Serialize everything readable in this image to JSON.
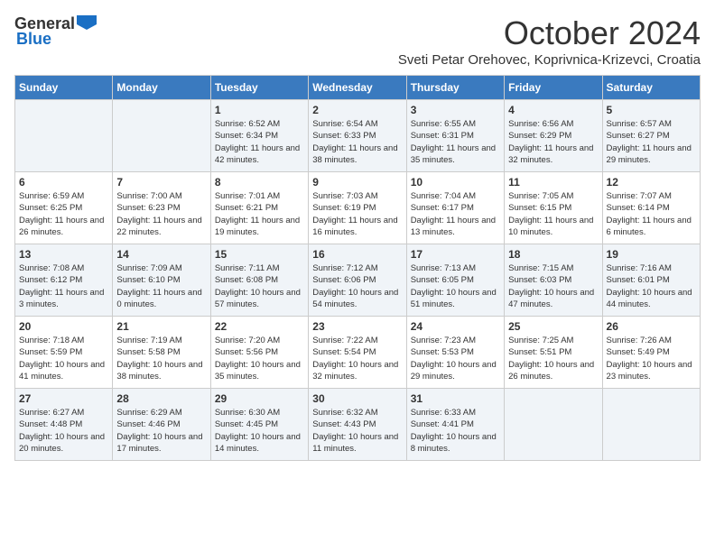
{
  "header": {
    "logo_general": "General",
    "logo_blue": "Blue",
    "month": "October 2024",
    "location": "Sveti Petar Orehovec, Koprivnica-Krizevci, Croatia"
  },
  "weekdays": [
    "Sunday",
    "Monday",
    "Tuesday",
    "Wednesday",
    "Thursday",
    "Friday",
    "Saturday"
  ],
  "weeks": [
    [
      {
        "day": "",
        "info": ""
      },
      {
        "day": "",
        "info": ""
      },
      {
        "day": "1",
        "info": "Sunrise: 6:52 AM\nSunset: 6:34 PM\nDaylight: 11 hours and 42 minutes."
      },
      {
        "day": "2",
        "info": "Sunrise: 6:54 AM\nSunset: 6:33 PM\nDaylight: 11 hours and 38 minutes."
      },
      {
        "day": "3",
        "info": "Sunrise: 6:55 AM\nSunset: 6:31 PM\nDaylight: 11 hours and 35 minutes."
      },
      {
        "day": "4",
        "info": "Sunrise: 6:56 AM\nSunset: 6:29 PM\nDaylight: 11 hours and 32 minutes."
      },
      {
        "day": "5",
        "info": "Sunrise: 6:57 AM\nSunset: 6:27 PM\nDaylight: 11 hours and 29 minutes."
      }
    ],
    [
      {
        "day": "6",
        "info": "Sunrise: 6:59 AM\nSunset: 6:25 PM\nDaylight: 11 hours and 26 minutes."
      },
      {
        "day": "7",
        "info": "Sunrise: 7:00 AM\nSunset: 6:23 PM\nDaylight: 11 hours and 22 minutes."
      },
      {
        "day": "8",
        "info": "Sunrise: 7:01 AM\nSunset: 6:21 PM\nDaylight: 11 hours and 19 minutes."
      },
      {
        "day": "9",
        "info": "Sunrise: 7:03 AM\nSunset: 6:19 PM\nDaylight: 11 hours and 16 minutes."
      },
      {
        "day": "10",
        "info": "Sunrise: 7:04 AM\nSunset: 6:17 PM\nDaylight: 11 hours and 13 minutes."
      },
      {
        "day": "11",
        "info": "Sunrise: 7:05 AM\nSunset: 6:15 PM\nDaylight: 11 hours and 10 minutes."
      },
      {
        "day": "12",
        "info": "Sunrise: 7:07 AM\nSunset: 6:14 PM\nDaylight: 11 hours and 6 minutes."
      }
    ],
    [
      {
        "day": "13",
        "info": "Sunrise: 7:08 AM\nSunset: 6:12 PM\nDaylight: 11 hours and 3 minutes."
      },
      {
        "day": "14",
        "info": "Sunrise: 7:09 AM\nSunset: 6:10 PM\nDaylight: 11 hours and 0 minutes."
      },
      {
        "day": "15",
        "info": "Sunrise: 7:11 AM\nSunset: 6:08 PM\nDaylight: 10 hours and 57 minutes."
      },
      {
        "day": "16",
        "info": "Sunrise: 7:12 AM\nSunset: 6:06 PM\nDaylight: 10 hours and 54 minutes."
      },
      {
        "day": "17",
        "info": "Sunrise: 7:13 AM\nSunset: 6:05 PM\nDaylight: 10 hours and 51 minutes."
      },
      {
        "day": "18",
        "info": "Sunrise: 7:15 AM\nSunset: 6:03 PM\nDaylight: 10 hours and 47 minutes."
      },
      {
        "day": "19",
        "info": "Sunrise: 7:16 AM\nSunset: 6:01 PM\nDaylight: 10 hours and 44 minutes."
      }
    ],
    [
      {
        "day": "20",
        "info": "Sunrise: 7:18 AM\nSunset: 5:59 PM\nDaylight: 10 hours and 41 minutes."
      },
      {
        "day": "21",
        "info": "Sunrise: 7:19 AM\nSunset: 5:58 PM\nDaylight: 10 hours and 38 minutes."
      },
      {
        "day": "22",
        "info": "Sunrise: 7:20 AM\nSunset: 5:56 PM\nDaylight: 10 hours and 35 minutes."
      },
      {
        "day": "23",
        "info": "Sunrise: 7:22 AM\nSunset: 5:54 PM\nDaylight: 10 hours and 32 minutes."
      },
      {
        "day": "24",
        "info": "Sunrise: 7:23 AM\nSunset: 5:53 PM\nDaylight: 10 hours and 29 minutes."
      },
      {
        "day": "25",
        "info": "Sunrise: 7:25 AM\nSunset: 5:51 PM\nDaylight: 10 hours and 26 minutes."
      },
      {
        "day": "26",
        "info": "Sunrise: 7:26 AM\nSunset: 5:49 PM\nDaylight: 10 hours and 23 minutes."
      }
    ],
    [
      {
        "day": "27",
        "info": "Sunrise: 6:27 AM\nSunset: 4:48 PM\nDaylight: 10 hours and 20 minutes."
      },
      {
        "day": "28",
        "info": "Sunrise: 6:29 AM\nSunset: 4:46 PM\nDaylight: 10 hours and 17 minutes."
      },
      {
        "day": "29",
        "info": "Sunrise: 6:30 AM\nSunset: 4:45 PM\nDaylight: 10 hours and 14 minutes."
      },
      {
        "day": "30",
        "info": "Sunrise: 6:32 AM\nSunset: 4:43 PM\nDaylight: 10 hours and 11 minutes."
      },
      {
        "day": "31",
        "info": "Sunrise: 6:33 AM\nSunset: 4:41 PM\nDaylight: 10 hours and 8 minutes."
      },
      {
        "day": "",
        "info": ""
      },
      {
        "day": "",
        "info": ""
      }
    ]
  ]
}
